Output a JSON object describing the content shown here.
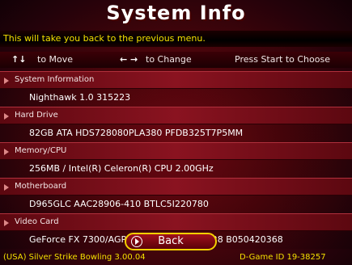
{
  "title": "System Info",
  "hint": "This will take you back to the previous menu.",
  "controls": {
    "move_arrows": "↑↓",
    "move_label": "to Move",
    "change_arrows": "← →",
    "change_label": "to Change",
    "start_label": "Press Start to Choose"
  },
  "sections": [
    {
      "label": "System Information",
      "value": "Nighthawk 1.0 315223"
    },
    {
      "label": "Hard Drive",
      "value": "82GB ATA HDS728080PLA380 PFDB325T7P5MM"
    },
    {
      "label": "Memory/CPU",
      "value": "256MB / Intel(R) Celeron(R) CPU 2.00GHz"
    },
    {
      "label": "Motherboard",
      "value": "D965GLC AAC28906-410 BTLC5I220780"
    },
    {
      "label": "Video Card",
      "value": "GeForce FX 7300/AGP/SSE2, FX5200-TD128 B050420368"
    }
  ],
  "back_label": "Back",
  "footer": {
    "left": "(USA) Silver Strike Bowling 3.00.04",
    "right": "D-Game ID 19-38257"
  }
}
